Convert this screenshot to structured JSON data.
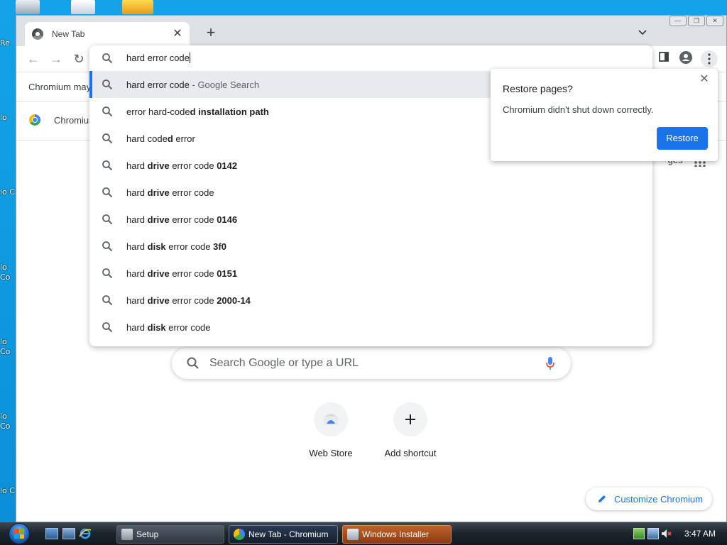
{
  "browser": {
    "tab": {
      "title": "New Tab"
    },
    "omnibox": {
      "query": "hard error code",
      "suggestions": [
        {
          "prefix": "hard error code",
          "bold": "",
          "rest": "",
          "suffix": " - Google Search"
        },
        {
          "prefix": "error hard-code",
          "bold": "d installation path",
          "rest": "",
          "suffix": ""
        },
        {
          "prefix": "hard code",
          "bold": "d",
          "rest": " error",
          "suffix": ""
        },
        {
          "prefix": "hard ",
          "bold": "drive",
          "rest": " error code ",
          "bold2": "0142"
        },
        {
          "prefix": "hard ",
          "bold": "drive",
          "rest": " error code",
          "bold2": ""
        },
        {
          "prefix": "hard ",
          "bold": "drive",
          "rest": " error code ",
          "bold2": "0146"
        },
        {
          "prefix": "hard ",
          "bold": "disk",
          "rest": " error code ",
          "bold2": "3f0"
        },
        {
          "prefix": "hard ",
          "bold": "drive",
          "rest": " error code ",
          "bold2": "0151"
        },
        {
          "prefix": "hard ",
          "bold": "drive",
          "rest": " error code ",
          "bold2": "2000-14"
        },
        {
          "prefix": "hard ",
          "bold": "disk",
          "rest": " error code",
          "bold2": ""
        }
      ]
    },
    "infobar": {
      "text": "Chromium may"
    },
    "bookmark": {
      "label": "Chromiu"
    },
    "ntp": {
      "images_link": "Images",
      "search_placeholder": "Search Google or type a URL",
      "shortcuts": [
        {
          "label": "Web Store"
        },
        {
          "label": "Add shortcut"
        }
      ],
      "customize_label": "Customize Chromium"
    },
    "restore_bubble": {
      "title": "Restore pages?",
      "body": "Chromium didn't shut down correctly.",
      "button": "Restore"
    }
  },
  "desktop": {
    "fragments": [
      "Re",
      "lo",
      "lo C",
      "lo Co",
      "lo Co",
      "lo Co",
      "lo C"
    ]
  },
  "taskbar": {
    "items": [
      {
        "label": "Setup"
      },
      {
        "label": "New Tab - Chromium"
      },
      {
        "label": "Windows Installer"
      }
    ],
    "clock": "3:47 AM"
  },
  "colors": {
    "accent": "#1a73e8",
    "desktop": "#0b8ed8",
    "selected_row": "#e8eaed"
  },
  "icons": [
    "search-icon",
    "mic-icon",
    "plus-icon",
    "close-icon",
    "chrome-icon",
    "pencil-icon",
    "back-icon",
    "forward-icon",
    "reload-icon",
    "profile-icon",
    "menu-icon",
    "sidepanel-icon"
  ]
}
